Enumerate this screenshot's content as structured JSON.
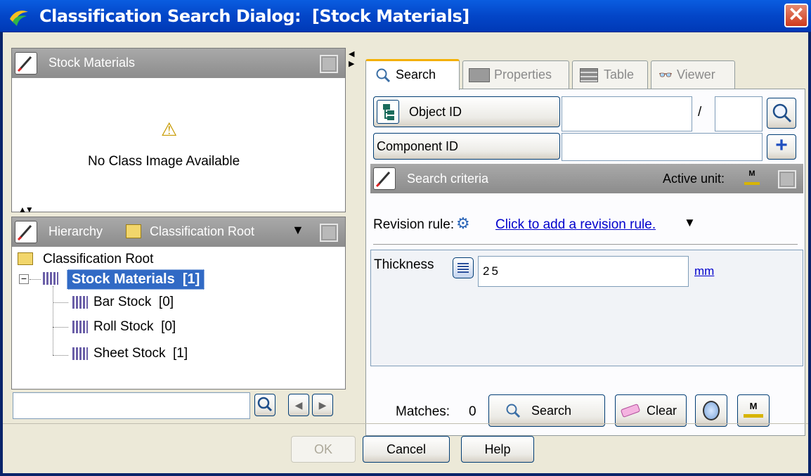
{
  "window": {
    "title": "Classification Search Dialog:",
    "context": "[Stock Materials]",
    "close_glyph": "✕"
  },
  "left_top_panel": {
    "header": "Stock Materials",
    "warning_glyph": "⚠",
    "no_image_text": "No Class Image Available"
  },
  "hierarchy": {
    "header_label": "Hierarchy",
    "root_selector": "Classification Root",
    "tree": [
      {
        "label": "Classification Root"
      },
      {
        "label": "Stock Materials  [1]",
        "selected": true,
        "expander": "−"
      },
      {
        "label": "Bar Stock  [0]"
      },
      {
        "label": "Roll Stock  [0]"
      },
      {
        "label": "Sheet Stock  [1]"
      }
    ],
    "search_value": ""
  },
  "tabs": [
    {
      "label": "Search",
      "active": true
    },
    {
      "label": "Properties",
      "active": false
    },
    {
      "label": "Table",
      "active": false
    },
    {
      "label": "Viewer",
      "active": false
    }
  ],
  "search_tab": {
    "object_id_label": "Object ID",
    "object_id_value": "",
    "separator": "/",
    "revision_value": "",
    "component_id_label": "Component ID",
    "component_id_value": "",
    "add_glyph": "+",
    "criteria_header": "Search criteria",
    "active_unit_label": "Active unit:",
    "unit_glyph": "M",
    "revision_rule_label": "Revision rule:",
    "revision_rule_link": "Click to add a revision rule.",
    "attribute_name": "Thickness",
    "attribute_value": "25",
    "attribute_unit": "mm",
    "matches_label": "Matches:",
    "matches_count": "0",
    "search_button": "Search",
    "clear_button": "Clear"
  },
  "footer": {
    "ok": "OK",
    "cancel": "Cancel",
    "help": "Help"
  },
  "colors": {
    "title_bar": "#0346c8",
    "selection": "#316ac5",
    "panel_header": "#9a9a9a",
    "link": "#0000cc"
  }
}
